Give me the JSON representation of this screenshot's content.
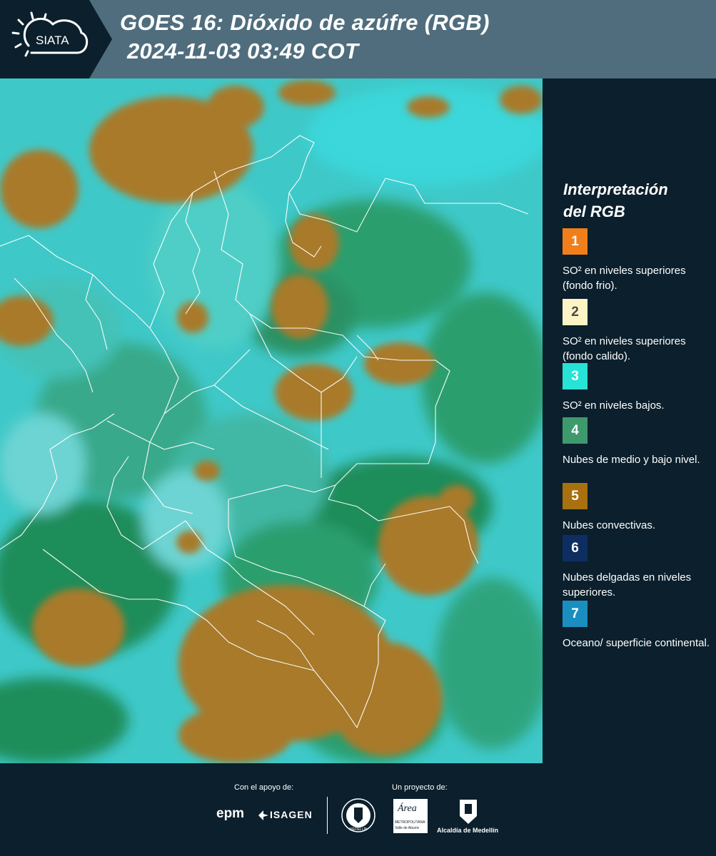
{
  "header": {
    "logo_text": "SIATA",
    "title_line1": "GOES 16: Dióxido de azúfre (RGB)",
    "title_line2": "2024-11-03 03:49 COT"
  },
  "legend": {
    "title_line1": "Interpretación",
    "title_line2": "del RGB",
    "items": [
      {
        "number": "1",
        "color": "#f07f1b",
        "text": "SO² en niveles superiores (fondo frio)."
      },
      {
        "number": "2",
        "color": "#fdf4c6",
        "text": "SO² en niveles superiores (fondo calido)."
      },
      {
        "number": "3",
        "color": "#27e3d6",
        "text": "SO² en niveles bajos."
      },
      {
        "number": "4",
        "color": "#3e9a6d",
        "text": "Nubes de medio y bajo nivel."
      },
      {
        "number": "5",
        "color": "#a8700f",
        "text": "Nubes convectivas."
      },
      {
        "number": "6",
        "color": "#0e2e62",
        "text": "Nubes delgadas en niveles superiores."
      },
      {
        "number": "7",
        "color": "#1a8fbf",
        "text": "Oceano/ superficie continental."
      }
    ]
  },
  "footer": {
    "support_label": "Con el apoyo de:",
    "project_label": "Un proyecto de:",
    "sponsor1": "epm",
    "sponsor2": "ISAGEN",
    "partner_area_line1": "Área",
    "partner_area_line2": "METROPOLITANA",
    "partner_area_line3": "Valle de Aburrá",
    "partner_alcaldia": "Alcaldía de Medellín",
    "seal_text": "MEDELLÍN"
  },
  "colors": {
    "background": "#0b1f2c",
    "header_band": "#4f6d7d",
    "map_cyan": "#27d7d6",
    "map_green": "#1f8a4e",
    "map_brown": "#a87a2a"
  }
}
